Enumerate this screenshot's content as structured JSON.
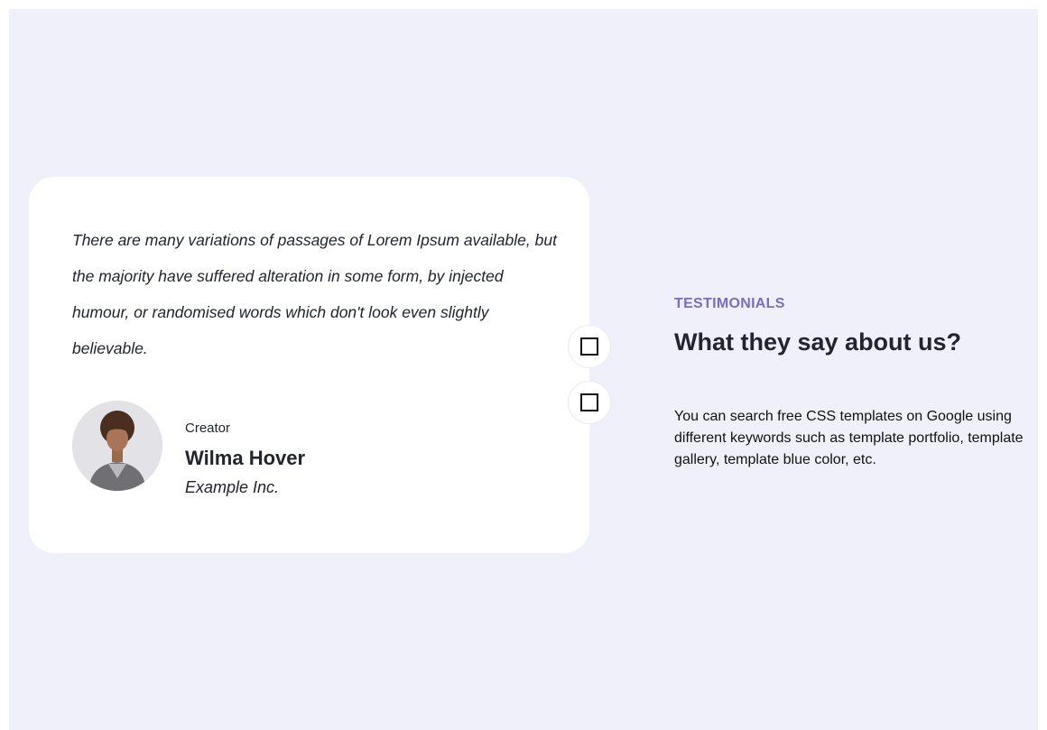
{
  "testimonial": {
    "quote": "There are many variations of passages of Lorem Ipsum available, but the majority have suffered alteration in some form, by injected humour, or randomised words which don't look even slightly believable.",
    "author": {
      "role": "Creator",
      "name": "Wilma Hover",
      "company": "Example Inc."
    }
  },
  "navigation": {
    "prev_icon": "square-icon",
    "next_icon": "square-icon"
  },
  "section": {
    "eyebrow": "TESTIMONIALS",
    "title": "What they say about us?",
    "description": "You can search free CSS templates on Google using different keywords such as template portfolio, template gallery, template blue color, etc."
  },
  "colors": {
    "page_background": "#f0f0fb",
    "card_background": "#ffffff",
    "accent": "#7b6bc9",
    "text": "#222430"
  }
}
